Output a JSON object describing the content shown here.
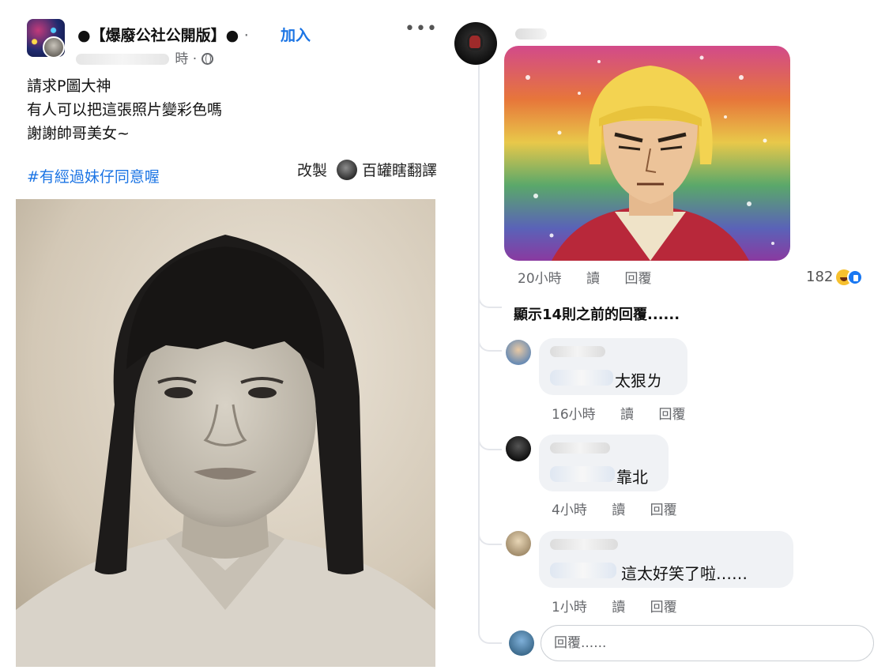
{
  "post": {
    "group_name": "●【爆廢公社公開版】●",
    "separator": "·",
    "join_label": "加入",
    "more_label": "•••",
    "time_suffix": "時 ·",
    "body_lines": [
      "請求P圖大神",
      "有人可以把這張照片變彩色嗎",
      "謝謝帥哥美女~"
    ],
    "hashtag": "#有經過妹仔同意喔",
    "remix_label": "改製",
    "remix_author": "百罐瞎翻譯"
  },
  "comments": {
    "top": {
      "time": "20小時",
      "read_label": "讀",
      "reply_label": "回覆",
      "reaction_count": "182"
    },
    "show_more": "顯示14則之前的回覆......",
    "replies": [
      {
        "text": "太狠ㄌ",
        "time": "16小時",
        "read_label": "讀",
        "reply_label": "回覆"
      },
      {
        "text": "靠北",
        "time": "4小時",
        "read_label": "讀",
        "reply_label": "回覆"
      },
      {
        "text": "這太好笑了啦……",
        "time": "1小時",
        "read_label": "讀",
        "reply_label": "回覆"
      }
    ],
    "reply_placeholder": "回覆......"
  },
  "colors": {
    "link": "#1b74e4",
    "meta": "#65676b",
    "bubble": "#f0f2f5"
  }
}
